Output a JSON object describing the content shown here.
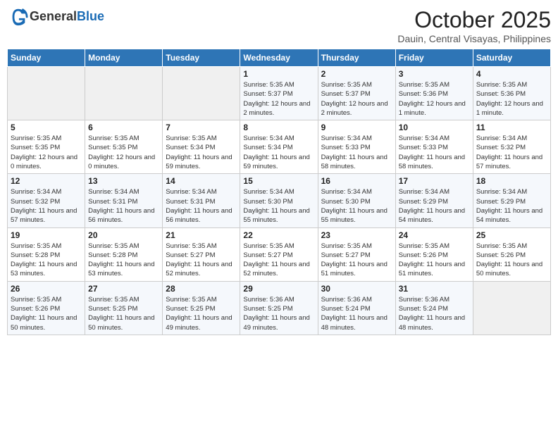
{
  "header": {
    "logo_line1": "General",
    "logo_line2": "Blue",
    "month": "October 2025",
    "location": "Dauin, Central Visayas, Philippines"
  },
  "weekdays": [
    "Sunday",
    "Monday",
    "Tuesday",
    "Wednesday",
    "Thursday",
    "Friday",
    "Saturday"
  ],
  "weeks": [
    [
      {
        "day": "",
        "info": ""
      },
      {
        "day": "",
        "info": ""
      },
      {
        "day": "",
        "info": ""
      },
      {
        "day": "1",
        "info": "Sunrise: 5:35 AM\nSunset: 5:37 PM\nDaylight: 12 hours and 2 minutes."
      },
      {
        "day": "2",
        "info": "Sunrise: 5:35 AM\nSunset: 5:37 PM\nDaylight: 12 hours and 2 minutes."
      },
      {
        "day": "3",
        "info": "Sunrise: 5:35 AM\nSunset: 5:36 PM\nDaylight: 12 hours and 1 minute."
      },
      {
        "day": "4",
        "info": "Sunrise: 5:35 AM\nSunset: 5:36 PM\nDaylight: 12 hours and 1 minute."
      }
    ],
    [
      {
        "day": "5",
        "info": "Sunrise: 5:35 AM\nSunset: 5:35 PM\nDaylight: 12 hours and 0 minutes."
      },
      {
        "day": "6",
        "info": "Sunrise: 5:35 AM\nSunset: 5:35 PM\nDaylight: 12 hours and 0 minutes."
      },
      {
        "day": "7",
        "info": "Sunrise: 5:35 AM\nSunset: 5:34 PM\nDaylight: 11 hours and 59 minutes."
      },
      {
        "day": "8",
        "info": "Sunrise: 5:34 AM\nSunset: 5:34 PM\nDaylight: 11 hours and 59 minutes."
      },
      {
        "day": "9",
        "info": "Sunrise: 5:34 AM\nSunset: 5:33 PM\nDaylight: 11 hours and 58 minutes."
      },
      {
        "day": "10",
        "info": "Sunrise: 5:34 AM\nSunset: 5:33 PM\nDaylight: 11 hours and 58 minutes."
      },
      {
        "day": "11",
        "info": "Sunrise: 5:34 AM\nSunset: 5:32 PM\nDaylight: 11 hours and 57 minutes."
      }
    ],
    [
      {
        "day": "12",
        "info": "Sunrise: 5:34 AM\nSunset: 5:32 PM\nDaylight: 11 hours and 57 minutes."
      },
      {
        "day": "13",
        "info": "Sunrise: 5:34 AM\nSunset: 5:31 PM\nDaylight: 11 hours and 56 minutes."
      },
      {
        "day": "14",
        "info": "Sunrise: 5:34 AM\nSunset: 5:31 PM\nDaylight: 11 hours and 56 minutes."
      },
      {
        "day": "15",
        "info": "Sunrise: 5:34 AM\nSunset: 5:30 PM\nDaylight: 11 hours and 55 minutes."
      },
      {
        "day": "16",
        "info": "Sunrise: 5:34 AM\nSunset: 5:30 PM\nDaylight: 11 hours and 55 minutes."
      },
      {
        "day": "17",
        "info": "Sunrise: 5:34 AM\nSunset: 5:29 PM\nDaylight: 11 hours and 54 minutes."
      },
      {
        "day": "18",
        "info": "Sunrise: 5:34 AM\nSunset: 5:29 PM\nDaylight: 11 hours and 54 minutes."
      }
    ],
    [
      {
        "day": "19",
        "info": "Sunrise: 5:35 AM\nSunset: 5:28 PM\nDaylight: 11 hours and 53 minutes."
      },
      {
        "day": "20",
        "info": "Sunrise: 5:35 AM\nSunset: 5:28 PM\nDaylight: 11 hours and 53 minutes."
      },
      {
        "day": "21",
        "info": "Sunrise: 5:35 AM\nSunset: 5:27 PM\nDaylight: 11 hours and 52 minutes."
      },
      {
        "day": "22",
        "info": "Sunrise: 5:35 AM\nSunset: 5:27 PM\nDaylight: 11 hours and 52 minutes."
      },
      {
        "day": "23",
        "info": "Sunrise: 5:35 AM\nSunset: 5:27 PM\nDaylight: 11 hours and 51 minutes."
      },
      {
        "day": "24",
        "info": "Sunrise: 5:35 AM\nSunset: 5:26 PM\nDaylight: 11 hours and 51 minutes."
      },
      {
        "day": "25",
        "info": "Sunrise: 5:35 AM\nSunset: 5:26 PM\nDaylight: 11 hours and 50 minutes."
      }
    ],
    [
      {
        "day": "26",
        "info": "Sunrise: 5:35 AM\nSunset: 5:26 PM\nDaylight: 11 hours and 50 minutes."
      },
      {
        "day": "27",
        "info": "Sunrise: 5:35 AM\nSunset: 5:25 PM\nDaylight: 11 hours and 50 minutes."
      },
      {
        "day": "28",
        "info": "Sunrise: 5:35 AM\nSunset: 5:25 PM\nDaylight: 11 hours and 49 minutes."
      },
      {
        "day": "29",
        "info": "Sunrise: 5:36 AM\nSunset: 5:25 PM\nDaylight: 11 hours and 49 minutes."
      },
      {
        "day": "30",
        "info": "Sunrise: 5:36 AM\nSunset: 5:24 PM\nDaylight: 11 hours and 48 minutes."
      },
      {
        "day": "31",
        "info": "Sunrise: 5:36 AM\nSunset: 5:24 PM\nDaylight: 11 hours and 48 minutes."
      },
      {
        "day": "",
        "info": ""
      }
    ]
  ]
}
